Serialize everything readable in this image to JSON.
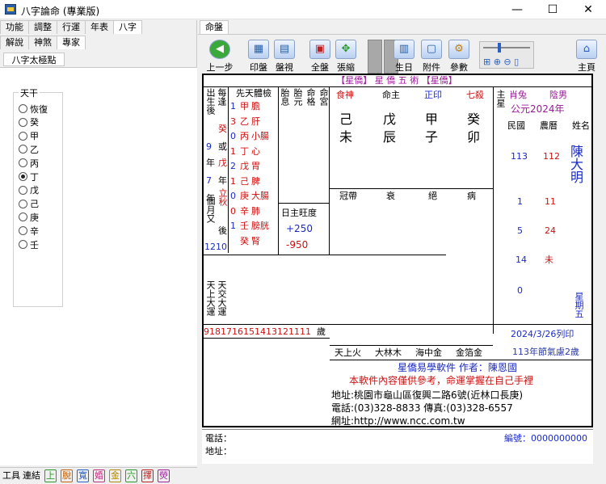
{
  "window": {
    "title": "八字論命 (專業版)",
    "minimize": "—",
    "maximize": "☐",
    "close": "✕"
  },
  "left_tabs_row1": [
    "功能",
    "調整",
    "行運",
    "年表",
    "八字"
  ],
  "left_tabs_row2": [
    "解說",
    "神煞",
    "專家"
  ],
  "subtab": "八字太極點",
  "group": {
    "title": "天干",
    "options": [
      "恢復",
      "癸",
      "甲",
      "乙",
      "丙",
      "丁",
      "戊",
      "己",
      "庚",
      "辛",
      "壬"
    ],
    "selected": "丁"
  },
  "bottom": {
    "tools": "工具",
    "link": "連結",
    "icons": [
      "上",
      "脫",
      "寬",
      "婚",
      "金",
      "六",
      "擇",
      "熒"
    ]
  },
  "right_tab": "命盤",
  "toolbar": {
    "prev": "上一步",
    "print": "印盤",
    "view": "盤視",
    "full": "全盤",
    "spread": "張縮",
    "birthday": "生日",
    "attach": "附件",
    "param": "參數",
    "home": "主頁"
  },
  "chart": {
    "header": "【星僑】 星 僑 五 術 【星僑】",
    "left_col": {
      "chusheng": "出生後",
      "meifeng": "每逢",
      "a1": "9",
      "a2": "年",
      "a3": "7",
      "a4": "年",
      "a5": "個月又",
      "b1": "癸",
      "b2": "或",
      "b3": "戊",
      "b4": "年",
      "b5": "立秋",
      "b6": "後",
      "c1": "12",
      "c2": "10",
      "tianshang": "天上大運",
      "tianjiao": "天交大運"
    },
    "organs": {
      "title": "先天體檢",
      "nums": [
        "1",
        "3",
        "0",
        "1",
        "2",
        "1",
        "0",
        "0",
        "1"
      ],
      "stems": [
        "甲",
        "乙",
        "丙",
        "丁",
        "戊",
        "己",
        "庚",
        "辛",
        "壬",
        "癸"
      ],
      "organs": [
        "膽",
        "肝",
        "小腸",
        "心",
        "胃",
        "脾",
        "大腸",
        "肺",
        "膀胱",
        "腎"
      ]
    },
    "pillars_header": {
      "tai": "胎息",
      "taiyuan": "胎元",
      "minggong": "命格",
      "minggong2": "命宮"
    },
    "pillar_top": {
      "ss1": "食神",
      "ss2": "命主",
      "ss3": "正印",
      "ss4": "七殺",
      "zhuxing": "主星"
    },
    "stems_row": [
      "己",
      "戊",
      "甲",
      "癸"
    ],
    "branches_row": [
      "未",
      "辰",
      "子",
      "卯"
    ],
    "year": "公元2024年",
    "zodiac": "肖兔",
    "gender": "陰男",
    "name": "陳大明",
    "calendar": {
      "g": "民國",
      "n": "農曆",
      "name_label": "姓名",
      "gy": "113",
      "ny": "112",
      "gm": "1",
      "nm": "11",
      "gd": "5",
      "nd": "24",
      "gh": "14",
      "nh": "未",
      "gmin": "0",
      "w": "星期五"
    },
    "printed": "2024/3/26列印",
    "jiqi": "113年節氣慮2歲",
    "wangdu": "日主旺度",
    "v1": "+250",
    "v2": "-950",
    "nayin": [
      "天上火",
      "大林木",
      "海中金",
      "金箔金"
    ],
    "company": "星僑易學軟件 作者：陳恩國",
    "notice": "本軟件內容僅供參考，命運掌握在自己手裡",
    "address": "地址:桃園市龜山區復興二路6號(近林口長庚)",
    "phone": "電話:(03)328-8833 傳真:(03)328-6557",
    "web": "網址:http://www.ncc.com.tw",
    "stars": [
      "冠帶",
      "衰",
      "絕",
      "病"
    ],
    "luck_ages": [
      "91",
      "81",
      "71",
      "61",
      "51",
      "41",
      "31",
      "21",
      "11",
      "1"
    ],
    "age_label": "歲"
  },
  "footer": {
    "phone": "電話：",
    "address": "地址：",
    "serial": "編號：0000000000"
  }
}
